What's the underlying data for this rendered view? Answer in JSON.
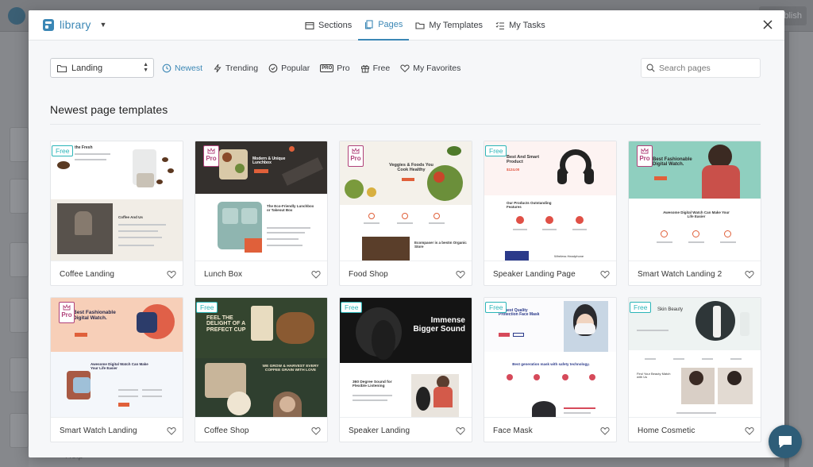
{
  "brand": {
    "name": "library"
  },
  "tabs": [
    {
      "label": "Sections",
      "icon": "sections-icon",
      "active": false
    },
    {
      "label": "Pages",
      "icon": "pages-icon",
      "active": true
    },
    {
      "label": "My Templates",
      "icon": "folder-icon",
      "active": false
    },
    {
      "label": "My Tasks",
      "icon": "tasks-icon",
      "active": false
    }
  ],
  "category_select": {
    "value": "Landing"
  },
  "filters": [
    {
      "label": "Newest",
      "icon": "newest-icon",
      "active": true
    },
    {
      "label": "Trending",
      "icon": "bolt-icon",
      "active": false
    },
    {
      "label": "Popular",
      "icon": "check-circle-icon",
      "active": false
    },
    {
      "label": "Pro",
      "icon": "pro-icon",
      "active": false
    },
    {
      "label": "Free",
      "icon": "gift-icon",
      "active": false
    },
    {
      "label": "My Favorites",
      "icon": "heart-icon",
      "active": false
    }
  ],
  "search": {
    "placeholder": "Search pages"
  },
  "section_title": "Newest page templates",
  "badges": {
    "free": "Free",
    "pro": "Pro"
  },
  "templates": [
    {
      "title": "Coffee Landing",
      "badge": "Free",
      "thumb_text": [
        "the Fresh",
        "Coffee And Us"
      ]
    },
    {
      "title": "Lunch Box",
      "badge": "Pro",
      "thumb_text": [
        "Modern & Unique Lunchbox",
        "The Eco-Friendly Lunchbox or Takeout Box"
      ]
    },
    {
      "title": "Food Shop",
      "badge": "Pro",
      "thumb_text": [
        "Veggies & Foods You Cook Healthy",
        "Ecompaser is a bestm Organic Store"
      ]
    },
    {
      "title": "Speaker Landing Page",
      "badge": "Free",
      "thumb_text": [
        "Best And Smart Product",
        "$124.00",
        "Our Products Outstanding Features",
        "Wireless Headphone"
      ]
    },
    {
      "title": "Smart Watch Landing 2",
      "badge": "Pro",
      "thumb_text": [
        "Best Fashionable Digital Watch.",
        "Awesome Digital Watch Can Make Your Life Easier"
      ]
    },
    {
      "title": "Smart Watch Landing",
      "badge": "Pro",
      "thumb_text": [
        "Best Fashionable Digital Watch.",
        "Awesome Digital Watch Can Make Your Life Easier"
      ]
    },
    {
      "title": "Coffee Shop",
      "badge": "Free",
      "thumb_text": [
        "FEEL THE DELIGHT OF A PREFECT CUP",
        "WE GROW & HARVEST EVERY COFFEE GRAIN WITH LOVE"
      ]
    },
    {
      "title": "Speaker Landing",
      "badge": "Free",
      "thumb_text": [
        "Immense Bigger Sound",
        "360 Degree Sound for Flexible Listening"
      ]
    },
    {
      "title": "Face Mask",
      "badge": "Free",
      "thumb_text": [
        "Highest Quality Protection Face Mask",
        "Best generation mask with safety technology."
      ]
    },
    {
      "title": "Home Cosmetic",
      "badge": "Free",
      "thumb_text": [
        "Skin Beauty",
        "Find Your Beauty Match with Us"
      ]
    }
  ],
  "background": {
    "publish": "blish",
    "help": "Help"
  },
  "colors": {
    "accent": "#3b87b5",
    "free_badge": "#2bb5b8",
    "pro_badge": "#b0427a",
    "chat_fab": "#2e5d78"
  }
}
